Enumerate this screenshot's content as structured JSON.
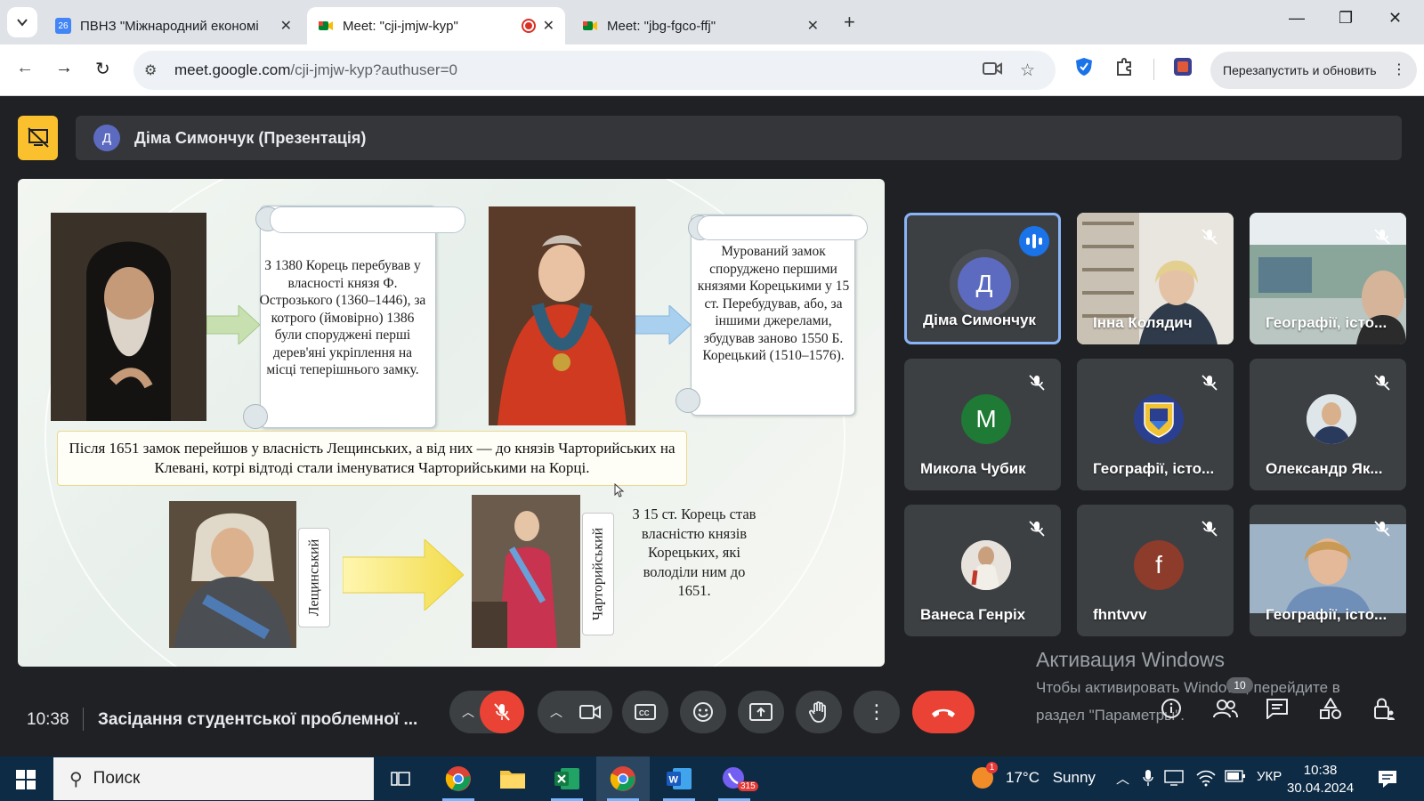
{
  "browser": {
    "tabs": [
      {
        "title": "ПВНЗ \"Міжнародний економі",
        "icon": "calendar-icon",
        "active": false
      },
      {
        "title": "Meet: \"cji-jmjw-kyp\"",
        "icon": "meet-icon",
        "active": true,
        "recording": true
      },
      {
        "title": "Meet: \"jbg-fgco-ffj\"",
        "icon": "meet-icon",
        "active": false
      }
    ],
    "url_host": "meet.google.com",
    "url_path": "/cji-jmjw-kyp?authuser=0",
    "relaunch_label": "Перезапустить и обновить"
  },
  "meet": {
    "presenter": {
      "initial": "Д",
      "label": "Діма Симончук (Презентація)"
    },
    "slide": {
      "scroll1": "З 1380 Корець перебував у власності князя Ф. Острозького (1360–1446), за котрого (ймовірно) 1386 були споруджені перші дерев'яні укріплення на місці теперішнього замку.",
      "scroll2": "Мурований замок споруджено першими князями Корецькими у 15 ст. Перебудував, або, за іншими джерелами, збудував заново 1550 Б. Корецький (1510–1576).",
      "main_box": "Після 1651 замок перейшов у власність Лещинських, а від них — до князів Чарторийських на Клевані, котрі відтоді стали іменуватися Чарторийськими на Корці.",
      "label_left": "Лещинський",
      "label_right": "Чарторийський",
      "note": "З 15 ст. Корець став власністю князів Корецьких, які володіли ним до 1651."
    },
    "participants": [
      {
        "name": "Діма Симончук",
        "initial": "Д",
        "color": "#5c6bc0",
        "speaking": true,
        "muted": false,
        "video": false
      },
      {
        "name": "Інна Колядич",
        "speaking": false,
        "muted": true,
        "video": true
      },
      {
        "name": "Географії, істо...",
        "speaking": false,
        "muted": true,
        "video": true
      },
      {
        "name": "Микола Чубик",
        "initial": "M",
        "color": "#1e7a34",
        "speaking": false,
        "muted": true,
        "video": false
      },
      {
        "name": "Географії, істо...",
        "initial": "",
        "color": "#2a3f8f",
        "speaking": false,
        "muted": true,
        "video": false
      },
      {
        "name": "Олександр Як...",
        "initial": "",
        "color": "#b0bec5",
        "speaking": false,
        "muted": true,
        "video": false
      },
      {
        "name": "Ванеса Генріх",
        "initial": "",
        "color": "#d7ccc8",
        "speaking": false,
        "muted": true,
        "video": false
      },
      {
        "name": "fhntvvv",
        "initial": "f",
        "color": "#8d3b2b",
        "speaking": false,
        "muted": true,
        "video": false
      },
      {
        "name": "Географії, істо...",
        "speaking": false,
        "muted": true,
        "video": true
      }
    ],
    "activation_title": "Активация Windows",
    "activation_text_1": "Чтобы активировать Windows, перейдите в",
    "activation_text_2": "раздел \"Параметры\".",
    "time": "10:38",
    "meeting_title": "Засідання студентської проблемної ...",
    "people_count": "10"
  },
  "taskbar": {
    "search_placeholder": "Поиск",
    "weather_temp": "17°C",
    "weather_desc": "Sunny",
    "language": "УКР",
    "clock_time": "10:38",
    "clock_date": "30.04.2024",
    "viber_badge": "315",
    "weather_badge": "1"
  }
}
